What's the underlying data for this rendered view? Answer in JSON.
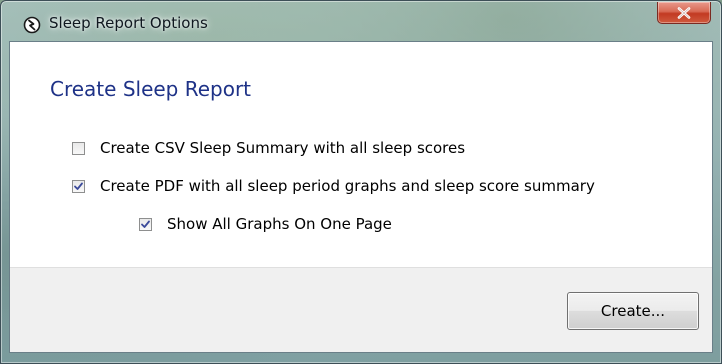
{
  "window": {
    "title": "Sleep Report Options",
    "close_label": "×"
  },
  "dialog": {
    "heading": "Create Sleep Report",
    "options": [
      {
        "label": "Create CSV Sleep Summary with all sleep scores",
        "checked": false
      },
      {
        "label": "Create PDF with all sleep period graphs and sleep score summary",
        "checked": true
      },
      {
        "label": "Show All Graphs On One Page",
        "checked": true
      }
    ],
    "create_button": "Create..."
  },
  "colors": {
    "heading": "#1e3287",
    "close_button": "#c23a22",
    "checkmark": "#3b4a9a"
  },
  "icons": {
    "app": "sleep-logo-icon",
    "close": "close-x-icon",
    "check": "checkmark-icon"
  }
}
